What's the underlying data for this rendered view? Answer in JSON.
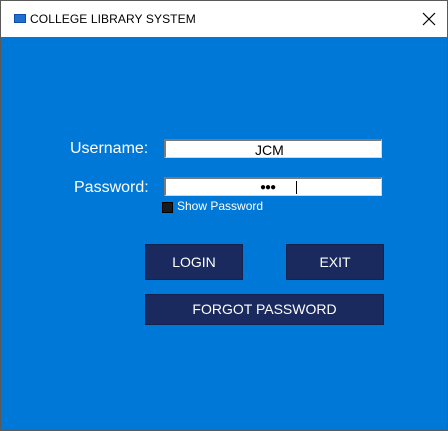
{
  "window": {
    "title": "COLLEGE LIBRARY SYSTEM",
    "close_glyph": "X"
  },
  "form": {
    "username_label": "Username:",
    "username_value": "JCM",
    "password_label": "Password:",
    "password_value": "●●●",
    "show_password_label": "Show Password",
    "show_password_checked": true
  },
  "buttons": {
    "login": "LOGIN",
    "exit": "EXIT",
    "forgot": "FORGOT PASSWORD"
  },
  "colors": {
    "background": "#0078d7",
    "button": "#1a2a5e"
  },
  "icons": {
    "app": "app-window-icon",
    "close": "close-icon"
  }
}
